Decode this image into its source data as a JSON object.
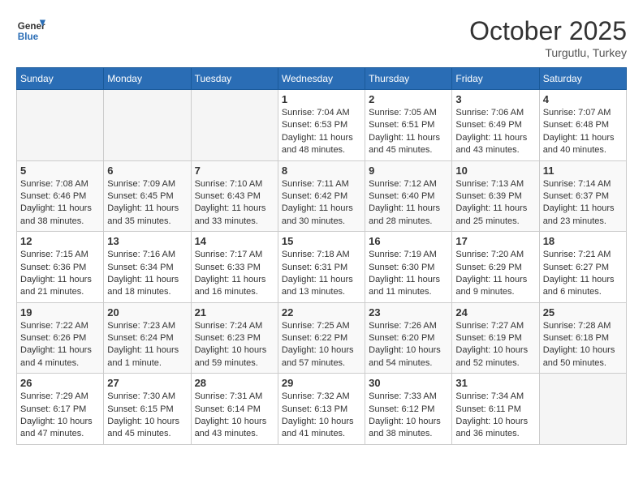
{
  "header": {
    "logo_line1": "General",
    "logo_line2": "Blue",
    "month": "October 2025",
    "location": "Turgutlu, Turkey"
  },
  "days_of_week": [
    "Sunday",
    "Monday",
    "Tuesday",
    "Wednesday",
    "Thursday",
    "Friday",
    "Saturday"
  ],
  "weeks": [
    [
      {
        "day": "",
        "content": ""
      },
      {
        "day": "",
        "content": ""
      },
      {
        "day": "",
        "content": ""
      },
      {
        "day": "1",
        "content": "Sunrise: 7:04 AM\nSunset: 6:53 PM\nDaylight: 11 hours\nand 48 minutes."
      },
      {
        "day": "2",
        "content": "Sunrise: 7:05 AM\nSunset: 6:51 PM\nDaylight: 11 hours\nand 45 minutes."
      },
      {
        "day": "3",
        "content": "Sunrise: 7:06 AM\nSunset: 6:49 PM\nDaylight: 11 hours\nand 43 minutes."
      },
      {
        "day": "4",
        "content": "Sunrise: 7:07 AM\nSunset: 6:48 PM\nDaylight: 11 hours\nand 40 minutes."
      }
    ],
    [
      {
        "day": "5",
        "content": "Sunrise: 7:08 AM\nSunset: 6:46 PM\nDaylight: 11 hours\nand 38 minutes."
      },
      {
        "day": "6",
        "content": "Sunrise: 7:09 AM\nSunset: 6:45 PM\nDaylight: 11 hours\nand 35 minutes."
      },
      {
        "day": "7",
        "content": "Sunrise: 7:10 AM\nSunset: 6:43 PM\nDaylight: 11 hours\nand 33 minutes."
      },
      {
        "day": "8",
        "content": "Sunrise: 7:11 AM\nSunset: 6:42 PM\nDaylight: 11 hours\nand 30 minutes."
      },
      {
        "day": "9",
        "content": "Sunrise: 7:12 AM\nSunset: 6:40 PM\nDaylight: 11 hours\nand 28 minutes."
      },
      {
        "day": "10",
        "content": "Sunrise: 7:13 AM\nSunset: 6:39 PM\nDaylight: 11 hours\nand 25 minutes."
      },
      {
        "day": "11",
        "content": "Sunrise: 7:14 AM\nSunset: 6:37 PM\nDaylight: 11 hours\nand 23 minutes."
      }
    ],
    [
      {
        "day": "12",
        "content": "Sunrise: 7:15 AM\nSunset: 6:36 PM\nDaylight: 11 hours\nand 21 minutes."
      },
      {
        "day": "13",
        "content": "Sunrise: 7:16 AM\nSunset: 6:34 PM\nDaylight: 11 hours\nand 18 minutes."
      },
      {
        "day": "14",
        "content": "Sunrise: 7:17 AM\nSunset: 6:33 PM\nDaylight: 11 hours\nand 16 minutes."
      },
      {
        "day": "15",
        "content": "Sunrise: 7:18 AM\nSunset: 6:31 PM\nDaylight: 11 hours\nand 13 minutes."
      },
      {
        "day": "16",
        "content": "Sunrise: 7:19 AM\nSunset: 6:30 PM\nDaylight: 11 hours\nand 11 minutes."
      },
      {
        "day": "17",
        "content": "Sunrise: 7:20 AM\nSunset: 6:29 PM\nDaylight: 11 hours\nand 9 minutes."
      },
      {
        "day": "18",
        "content": "Sunrise: 7:21 AM\nSunset: 6:27 PM\nDaylight: 11 hours\nand 6 minutes."
      }
    ],
    [
      {
        "day": "19",
        "content": "Sunrise: 7:22 AM\nSunset: 6:26 PM\nDaylight: 11 hours\nand 4 minutes."
      },
      {
        "day": "20",
        "content": "Sunrise: 7:23 AM\nSunset: 6:24 PM\nDaylight: 11 hours\nand 1 minute."
      },
      {
        "day": "21",
        "content": "Sunrise: 7:24 AM\nSunset: 6:23 PM\nDaylight: 10 hours\nand 59 minutes."
      },
      {
        "day": "22",
        "content": "Sunrise: 7:25 AM\nSunset: 6:22 PM\nDaylight: 10 hours\nand 57 minutes."
      },
      {
        "day": "23",
        "content": "Sunrise: 7:26 AM\nSunset: 6:20 PM\nDaylight: 10 hours\nand 54 minutes."
      },
      {
        "day": "24",
        "content": "Sunrise: 7:27 AM\nSunset: 6:19 PM\nDaylight: 10 hours\nand 52 minutes."
      },
      {
        "day": "25",
        "content": "Sunrise: 7:28 AM\nSunset: 6:18 PM\nDaylight: 10 hours\nand 50 minutes."
      }
    ],
    [
      {
        "day": "26",
        "content": "Sunrise: 7:29 AM\nSunset: 6:17 PM\nDaylight: 10 hours\nand 47 minutes."
      },
      {
        "day": "27",
        "content": "Sunrise: 7:30 AM\nSunset: 6:15 PM\nDaylight: 10 hours\nand 45 minutes."
      },
      {
        "day": "28",
        "content": "Sunrise: 7:31 AM\nSunset: 6:14 PM\nDaylight: 10 hours\nand 43 minutes."
      },
      {
        "day": "29",
        "content": "Sunrise: 7:32 AM\nSunset: 6:13 PM\nDaylight: 10 hours\nand 41 minutes."
      },
      {
        "day": "30",
        "content": "Sunrise: 7:33 AM\nSunset: 6:12 PM\nDaylight: 10 hours\nand 38 minutes."
      },
      {
        "day": "31",
        "content": "Sunrise: 7:34 AM\nSunset: 6:11 PM\nDaylight: 10 hours\nand 36 minutes."
      },
      {
        "day": "",
        "content": ""
      }
    ]
  ]
}
